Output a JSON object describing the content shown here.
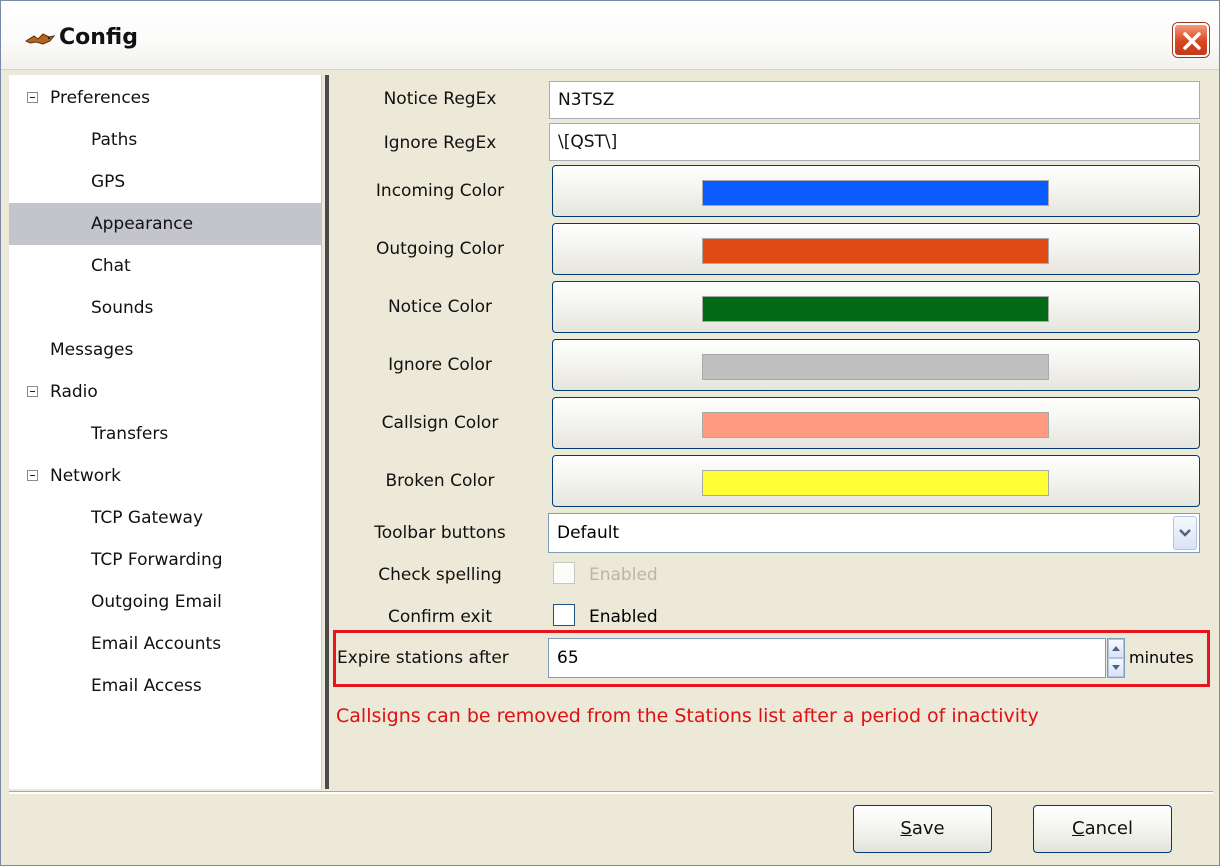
{
  "window": {
    "title": "Config"
  },
  "tree": [
    {
      "label": "Preferences",
      "expanded": true,
      "level": 0
    },
    {
      "label": "Paths",
      "level": 1
    },
    {
      "label": "GPS",
      "level": 1
    },
    {
      "label": "Appearance",
      "level": 1,
      "selected": true
    },
    {
      "label": "Chat",
      "level": 1
    },
    {
      "label": "Sounds",
      "level": 1
    },
    {
      "label": "Messages",
      "level": 0
    },
    {
      "label": "Radio",
      "expanded": true,
      "level": 0
    },
    {
      "label": "Transfers",
      "level": 1
    },
    {
      "label": "Network",
      "expanded": true,
      "level": 0
    },
    {
      "label": "TCP Gateway",
      "level": 1
    },
    {
      "label": "TCP Forwarding",
      "level": 1
    },
    {
      "label": "Outgoing Email",
      "level": 1
    },
    {
      "label": "Email Accounts",
      "level": 1
    },
    {
      "label": "Email Access",
      "level": 1
    }
  ],
  "form": {
    "notice_regex": {
      "label": "Notice RegEx",
      "value": "N3TSZ"
    },
    "ignore_regex": {
      "label": "Ignore RegEx",
      "value": "\\[QST\\]"
    },
    "colors": [
      {
        "label": "Incoming Color",
        "color": "#0a5cff"
      },
      {
        "label": "Outgoing Color",
        "color": "#e04a14"
      },
      {
        "label": "Notice Color",
        "color": "#006a14"
      },
      {
        "label": "Ignore Color",
        "color": "#c0c0c0"
      },
      {
        "label": "Callsign Color",
        "color": "#ff9b80"
      },
      {
        "label": "Broken Color",
        "color": "#ffff33"
      }
    ],
    "toolbar_buttons": {
      "label": "Toolbar buttons",
      "value": "Default"
    },
    "check_spelling": {
      "label": "Check spelling",
      "option": "Enabled",
      "checked": false,
      "disabled": true
    },
    "confirm_exit": {
      "label": "Confirm exit",
      "option": "Enabled",
      "checked": false
    },
    "expire_stations": {
      "label": "Expire stations after",
      "value": "65",
      "unit": "minutes"
    },
    "hint": "Callsigns can be removed from the Stations list after a period of inactivity"
  },
  "buttons": {
    "save_prefix": "",
    "save_accel": "S",
    "save_rest": "ave",
    "cancel_accel": "C",
    "cancel_rest": "ancel"
  }
}
